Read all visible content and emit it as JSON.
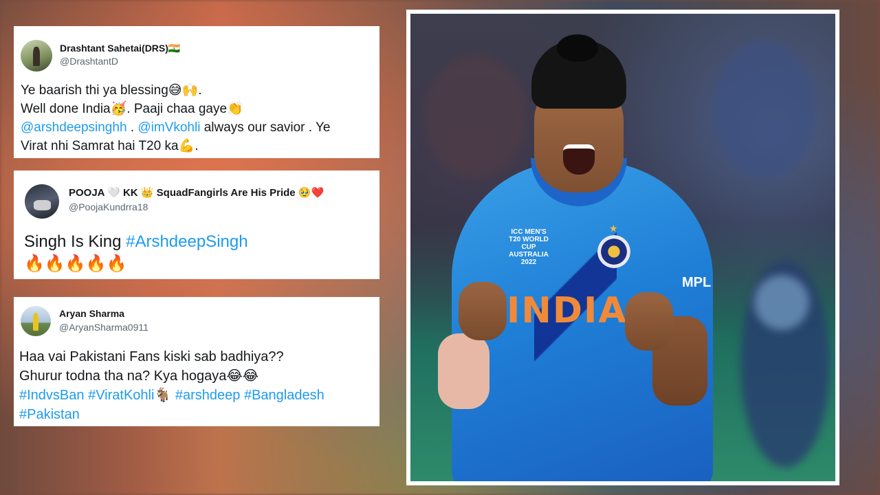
{
  "tweets": [
    {
      "name": "Drashtant Sahetai(DRS)🇮🇳",
      "handle": "@DrashtantD",
      "lines": [
        {
          "text": "Ye baarish thi ya blessing😅🙌.",
          "link": false
        },
        {
          "text": "Well done India🥳. Paaji chaa gaye👏",
          "link": false
        }
      ],
      "mention1": "@arshdeepsinghh",
      "sep1": " . ",
      "mention2": "@imVkohli",
      "after_mentions": " always our savior . Ye",
      "last_line": "Virat nhi Samrat hai T20 ka💪."
    },
    {
      "name": "POOJA 🤍 KK 👑 SquadFangirls Are His Pride 🥹❤️",
      "handle": "@PoojaKundrra18",
      "text_plain": "Singh Is King ",
      "hashtag": "#ArshdeepSingh",
      "emoji_line": "🔥🔥🔥🔥🔥"
    },
    {
      "name": "Aryan Sharma",
      "handle": "@AryanSharma0911",
      "line1": "Haa vai Pakistani Fans kiski sab badhiya??",
      "line2": "Ghurur todna tha na? Kya hogaya😂😂",
      "hashtags_line": "#IndvsBan #ViratKohli🐐 #arshdeep #Bangladesh",
      "hashtags_line2": "#Pakistan"
    }
  ],
  "photo": {
    "jersey_text": "INDIA",
    "logo_text": "ICC MEN'S T20 WORLD CUP AUSTRALIA 2022",
    "sponsor": "MPL"
  },
  "colors": {
    "link": "#1d9bf0",
    "jersey": "#1f7fd6",
    "jersey_text": "#f08a3a"
  }
}
